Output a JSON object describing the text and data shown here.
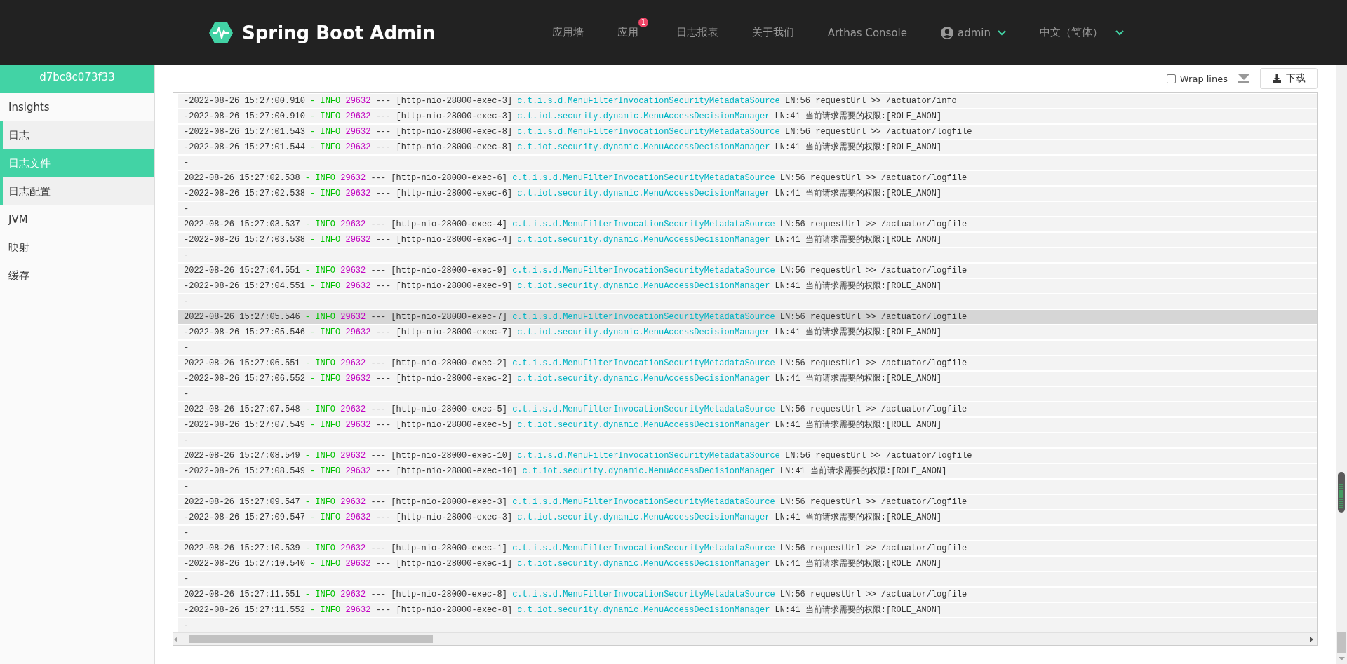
{
  "header": {
    "title": "Spring Boot Admin",
    "nav": [
      {
        "kind": "link",
        "label": "应用墙"
      },
      {
        "kind": "link",
        "label": "应用",
        "badge": "1"
      },
      {
        "kind": "link",
        "label": "日志报表"
      },
      {
        "kind": "link",
        "label": "关于我们"
      },
      {
        "kind": "link",
        "label": "Arthas Console"
      },
      {
        "kind": "user",
        "label": "admin"
      },
      {
        "kind": "dropdown",
        "label": "中文（简体）"
      }
    ]
  },
  "sidebar": {
    "instance": "d7bc8c073f33",
    "items": [
      {
        "label": "Insights",
        "selected": false
      },
      {
        "label": "日志",
        "selected": false,
        "expanded": true,
        "children": [
          {
            "label": "日志文件",
            "selected": true
          },
          {
            "label": "日志配置",
            "selected": false
          }
        ]
      },
      {
        "label": "JVM",
        "selected": false
      },
      {
        "label": "映射",
        "selected": false
      },
      {
        "label": "缓存",
        "selected": false
      }
    ]
  },
  "toolbar": {
    "wrap_lines": {
      "label": "Wrap lines",
      "checked": false
    },
    "download": {
      "label": "下载"
    }
  },
  "log": {
    "rows": [
      {
        "kind": "entry",
        "selected": false,
        "time": "-2022-08-26 15:27:00.910",
        "level": "- INFO",
        "pid": "29632",
        "thread": "--- [http-nio-28000-exec-3]",
        "logger": "c.t.i.s.d.MenuFilterInvocationSecurityMetadataSource",
        "message": "LN:56 requestUrl >> /actuator/info"
      },
      {
        "kind": "entry",
        "selected": false,
        "time": "-2022-08-26 15:27:00.910",
        "level": "- INFO",
        "pid": "29632",
        "thread": "--- [http-nio-28000-exec-3]",
        "logger": "c.t.iot.security.dynamic.MenuAccessDecisionManager",
        "message": "LN:41 当前请求需要的权限:[ROLE_ANON]"
      },
      {
        "kind": "entry",
        "selected": false,
        "time": "-2022-08-26 15:27:01.543",
        "level": "- INFO",
        "pid": "29632",
        "thread": "--- [http-nio-28000-exec-8]",
        "logger": "c.t.i.s.d.MenuFilterInvocationSecurityMetadataSource",
        "message": "LN:56 requestUrl >> /actuator/logfile"
      },
      {
        "kind": "entry",
        "selected": false,
        "time": "-2022-08-26 15:27:01.544",
        "level": "- INFO",
        "pid": "29632",
        "thread": "--- [http-nio-28000-exec-8]",
        "logger": "c.t.iot.security.dynamic.MenuAccessDecisionManager",
        "message": "LN:41 当前请求需要的权限:[ROLE_ANON]"
      },
      {
        "kind": "blank",
        "selected": false,
        "text": "-"
      },
      {
        "kind": "entry",
        "selected": false,
        "time": "2022-08-26 15:27:02.538",
        "level": "- INFO",
        "pid": "29632",
        "thread": "--- [http-nio-28000-exec-6]",
        "logger": "c.t.i.s.d.MenuFilterInvocationSecurityMetadataSource",
        "message": "LN:56 requestUrl >> /actuator/logfile"
      },
      {
        "kind": "entry",
        "selected": false,
        "time": "-2022-08-26 15:27:02.538",
        "level": "- INFO",
        "pid": "29632",
        "thread": "--- [http-nio-28000-exec-6]",
        "logger": "c.t.iot.security.dynamic.MenuAccessDecisionManager",
        "message": "LN:41 当前请求需要的权限:[ROLE_ANON]"
      },
      {
        "kind": "blank",
        "selected": false,
        "text": "-"
      },
      {
        "kind": "entry",
        "selected": false,
        "time": "2022-08-26 15:27:03.537",
        "level": "- INFO",
        "pid": "29632",
        "thread": "--- [http-nio-28000-exec-4]",
        "logger": "c.t.i.s.d.MenuFilterInvocationSecurityMetadataSource",
        "message": "LN:56 requestUrl >> /actuator/logfile"
      },
      {
        "kind": "entry",
        "selected": false,
        "time": "-2022-08-26 15:27:03.538",
        "level": "- INFO",
        "pid": "29632",
        "thread": "--- [http-nio-28000-exec-4]",
        "logger": "c.t.iot.security.dynamic.MenuAccessDecisionManager",
        "message": "LN:41 当前请求需要的权限:[ROLE_ANON]"
      },
      {
        "kind": "blank",
        "selected": false,
        "text": "-"
      },
      {
        "kind": "entry",
        "selected": false,
        "time": "2022-08-26 15:27:04.551",
        "level": "- INFO",
        "pid": "29632",
        "thread": "--- [http-nio-28000-exec-9]",
        "logger": "c.t.i.s.d.MenuFilterInvocationSecurityMetadataSource",
        "message": "LN:56 requestUrl >> /actuator/logfile"
      },
      {
        "kind": "entry",
        "selected": false,
        "time": "-2022-08-26 15:27:04.551",
        "level": "- INFO",
        "pid": "29632",
        "thread": "--- [http-nio-28000-exec-9]",
        "logger": "c.t.iot.security.dynamic.MenuAccessDecisionManager",
        "message": "LN:41 当前请求需要的权限:[ROLE_ANON]"
      },
      {
        "kind": "blank",
        "selected": false,
        "text": "-"
      },
      {
        "kind": "entry",
        "selected": true,
        "time": "2022-08-26 15:27:05.546",
        "level": "- INFO",
        "pid": "29632",
        "thread": "--- [http-nio-28000-exec-7]",
        "logger": "c.t.i.s.d.MenuFilterInvocationSecurityMetadataSource",
        "message": "LN:56 requestUrl >> /actuator/logfile"
      },
      {
        "kind": "entry",
        "selected": false,
        "time": "-2022-08-26 15:27:05.546",
        "level": "- INFO",
        "pid": "29632",
        "thread": "--- [http-nio-28000-exec-7]",
        "logger": "c.t.iot.security.dynamic.MenuAccessDecisionManager",
        "message": "LN:41 当前请求需要的权限:[ROLE_ANON]"
      },
      {
        "kind": "blank",
        "selected": false,
        "text": "-"
      },
      {
        "kind": "entry",
        "selected": false,
        "time": "2022-08-26 15:27:06.551",
        "level": "- INFO",
        "pid": "29632",
        "thread": "--- [http-nio-28000-exec-2]",
        "logger": "c.t.i.s.d.MenuFilterInvocationSecurityMetadataSource",
        "message": "LN:56 requestUrl >> /actuator/logfile"
      },
      {
        "kind": "entry",
        "selected": false,
        "time": "-2022-08-26 15:27:06.552",
        "level": "- INFO",
        "pid": "29632",
        "thread": "--- [http-nio-28000-exec-2]",
        "logger": "c.t.iot.security.dynamic.MenuAccessDecisionManager",
        "message": "LN:41 当前请求需要的权限:[ROLE_ANON]"
      },
      {
        "kind": "blank",
        "selected": false,
        "text": "-"
      },
      {
        "kind": "entry",
        "selected": false,
        "time": "2022-08-26 15:27:07.548",
        "level": "- INFO",
        "pid": "29632",
        "thread": "--- [http-nio-28000-exec-5]",
        "logger": "c.t.i.s.d.MenuFilterInvocationSecurityMetadataSource",
        "message": "LN:56 requestUrl >> /actuator/logfile"
      },
      {
        "kind": "entry",
        "selected": false,
        "time": "-2022-08-26 15:27:07.549",
        "level": "- INFO",
        "pid": "29632",
        "thread": "--- [http-nio-28000-exec-5]",
        "logger": "c.t.iot.security.dynamic.MenuAccessDecisionManager",
        "message": "LN:41 当前请求需要的权限:[ROLE_ANON]"
      },
      {
        "kind": "blank",
        "selected": false,
        "text": "-"
      },
      {
        "kind": "entry",
        "selected": false,
        "time": "2022-08-26 15:27:08.549",
        "level": "- INFO",
        "pid": "29632",
        "thread": "--- [http-nio-28000-exec-10]",
        "logger": "c.t.i.s.d.MenuFilterInvocationSecurityMetadataSource",
        "message": "LN:56 requestUrl >> /actuator/logfile"
      },
      {
        "kind": "entry",
        "selected": false,
        "time": "-2022-08-26 15:27:08.549",
        "level": "- INFO",
        "pid": "29632",
        "thread": "--- [http-nio-28000-exec-10]",
        "logger": "c.t.iot.security.dynamic.MenuAccessDecisionManager",
        "message": "LN:41 当前请求需要的权限:[ROLE_ANON]"
      },
      {
        "kind": "blank",
        "selected": false,
        "text": "-"
      },
      {
        "kind": "entry",
        "selected": false,
        "time": "2022-08-26 15:27:09.547",
        "level": "- INFO",
        "pid": "29632",
        "thread": "--- [http-nio-28000-exec-3]",
        "logger": "c.t.i.s.d.MenuFilterInvocationSecurityMetadataSource",
        "message": "LN:56 requestUrl >> /actuator/logfile"
      },
      {
        "kind": "entry",
        "selected": false,
        "time": "-2022-08-26 15:27:09.547",
        "level": "- INFO",
        "pid": "29632",
        "thread": "--- [http-nio-28000-exec-3]",
        "logger": "c.t.iot.security.dynamic.MenuAccessDecisionManager",
        "message": "LN:41 当前请求需要的权限:[ROLE_ANON]"
      },
      {
        "kind": "blank",
        "selected": false,
        "text": "-"
      },
      {
        "kind": "entry",
        "selected": false,
        "time": "2022-08-26 15:27:10.539",
        "level": "- INFO",
        "pid": "29632",
        "thread": "--- [http-nio-28000-exec-1]",
        "logger": "c.t.i.s.d.MenuFilterInvocationSecurityMetadataSource",
        "message": "LN:56 requestUrl >> /actuator/logfile"
      },
      {
        "kind": "entry",
        "selected": false,
        "time": "-2022-08-26 15:27:10.540",
        "level": "- INFO",
        "pid": "29632",
        "thread": "--- [http-nio-28000-exec-1]",
        "logger": "c.t.iot.security.dynamic.MenuAccessDecisionManager",
        "message": "LN:41 当前请求需要的权限:[ROLE_ANON]"
      },
      {
        "kind": "blank",
        "selected": false,
        "text": "-"
      },
      {
        "kind": "entry",
        "selected": false,
        "time": "2022-08-26 15:27:11.551",
        "level": "- INFO",
        "pid": "29632",
        "thread": "--- [http-nio-28000-exec-8]",
        "logger": "c.t.i.s.d.MenuFilterInvocationSecurityMetadataSource",
        "message": "LN:56 requestUrl >> /actuator/logfile"
      },
      {
        "kind": "entry",
        "selected": false,
        "time": "-2022-08-26 15:27:11.552",
        "level": "- INFO",
        "pid": "29632",
        "thread": "--- [http-nio-28000-exec-8]",
        "logger": "c.t.iot.security.dynamic.MenuAccessDecisionManager",
        "message": "LN:41 当前请求需要的权限:[ROLE_ANON]"
      },
      {
        "kind": "blank",
        "selected": false,
        "text": "-"
      }
    ]
  }
}
